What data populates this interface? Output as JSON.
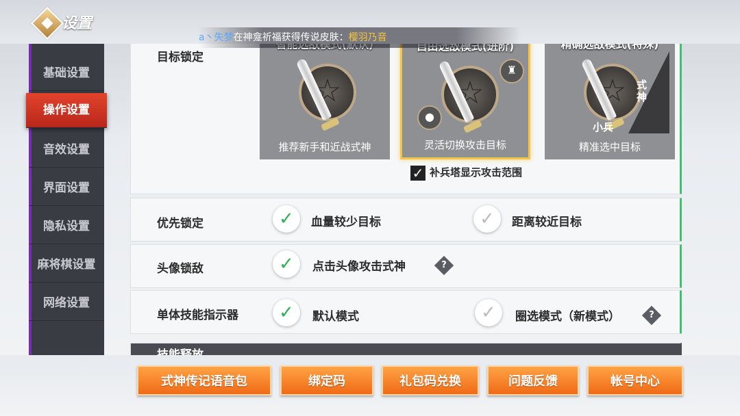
{
  "header": {
    "title": "设置",
    "ticker": {
      "user": "a丶失梦",
      "text": "在神龛祈福获得传说皮肤：",
      "item": "樱羽乃音"
    }
  },
  "sidebar": {
    "items": [
      {
        "label": "基础设置",
        "active": false
      },
      {
        "label": "操作设置",
        "active": true
      },
      {
        "label": "音效设置",
        "active": false
      },
      {
        "label": "界面设置",
        "active": false
      },
      {
        "label": "隐私设置",
        "active": false
      },
      {
        "label": "麻将棋设置",
        "active": false
      },
      {
        "label": "网络设置",
        "active": false
      }
    ]
  },
  "target_lock": {
    "label": "目标锁定",
    "modes": [
      {
        "title": "智能选敌模式(默认)",
        "desc": "推荐新手和近战式神",
        "selected": false
      },
      {
        "title": "自由选敌模式(进阶)",
        "desc": "灵活切换攻击目标",
        "selected": true
      },
      {
        "title": "精确选敌模式(特殊)",
        "desc": "精准选中目标",
        "selected": false,
        "marks": [
          "式神",
          "小兵"
        ]
      }
    ],
    "tower_range": {
      "label": "补兵塔显示攻击范围",
      "checked": true
    }
  },
  "priority_lock": {
    "label": "优先锁定",
    "options": [
      {
        "label": "血量较少目标",
        "checked": true
      },
      {
        "label": "距离较近目标",
        "checked": false
      }
    ]
  },
  "avatar_lock": {
    "label": "头像锁敌",
    "options": [
      {
        "label": "点击头像攻击式神",
        "checked": true
      }
    ],
    "help": "?"
  },
  "skill_indicator": {
    "label": "单体技能指示器",
    "options": [
      {
        "label": "默认模式",
        "checked": true
      },
      {
        "label": "圈选模式（新模式）",
        "checked": false
      }
    ],
    "help": "?"
  },
  "skill_release": {
    "label": "技能释放"
  },
  "footer": {
    "buttons": [
      "式神传记语音包",
      "绑定码",
      "礼包码兑换",
      "问题反馈",
      "帐号中心"
    ]
  },
  "colors": {
    "accent": "#e2432c",
    "check": "#2fb053",
    "button": "#f58a2a",
    "highlight": "#f3c64a"
  }
}
